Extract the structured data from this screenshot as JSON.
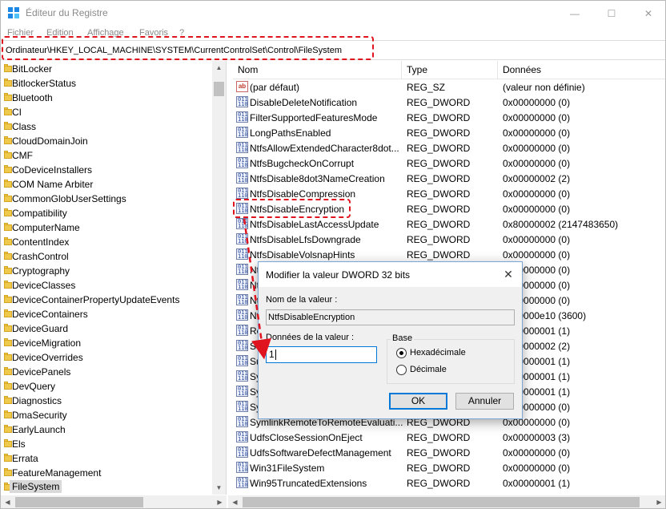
{
  "window": {
    "title": "Éditeur du Registre",
    "minimize_glyph": "—",
    "maximize_glyph": "☐",
    "close_glyph": "✕"
  },
  "menu": [
    "Fichier",
    "Edition",
    "Affichage",
    "Favoris",
    "?"
  ],
  "address": "Ordinateur\\HKEY_LOCAL_MACHINE\\SYSTEM\\CurrentControlSet\\Control\\FileSystem",
  "tree": {
    "items": [
      "BitLocker",
      "BitlockerStatus",
      "Bluetooth",
      "CI",
      "Class",
      "CloudDomainJoin",
      "CMF",
      "CoDeviceInstallers",
      "COM Name Arbiter",
      "CommonGlobUserSettings",
      "Compatibility",
      "ComputerName",
      "ContentIndex",
      "CrashControl",
      "Cryptography",
      "DeviceClasses",
      "DeviceContainerPropertyUpdateEvents",
      "DeviceContainers",
      "DeviceGuard",
      "DeviceMigration",
      "DeviceOverrides",
      "DevicePanels",
      "DevQuery",
      "Diagnostics",
      "DmaSecurity",
      "EarlyLaunch",
      "Els",
      "Errata",
      "FeatureManagement",
      "FileSystem"
    ],
    "selected": "FileSystem"
  },
  "list": {
    "headers": {
      "name": "Nom",
      "type": "Type",
      "data": "Données"
    },
    "rows": [
      {
        "icon": "string-value-icon",
        "name": "(par défaut)",
        "type": "REG_SZ",
        "data": "(valeur non définie)"
      },
      {
        "icon": "binary-value-icon",
        "name": "DisableDeleteNotification",
        "type": "REG_DWORD",
        "data": "0x00000000 (0)"
      },
      {
        "icon": "binary-value-icon",
        "name": "FilterSupportedFeaturesMode",
        "type": "REG_DWORD",
        "data": "0x00000000 (0)"
      },
      {
        "icon": "binary-value-icon",
        "name": "LongPathsEnabled",
        "type": "REG_DWORD",
        "data": "0x00000000 (0)"
      },
      {
        "icon": "binary-value-icon",
        "name": "NtfsAllowExtendedCharacter8dot...",
        "type": "REG_DWORD",
        "data": "0x00000000 (0)"
      },
      {
        "icon": "binary-value-icon",
        "name": "NtfsBugcheckOnCorrupt",
        "type": "REG_DWORD",
        "data": "0x00000000 (0)"
      },
      {
        "icon": "binary-value-icon",
        "name": "NtfsDisable8dot3NameCreation",
        "type": "REG_DWORD",
        "data": "0x00000002 (2)"
      },
      {
        "icon": "binary-value-icon",
        "name": "NtfsDisableCompression",
        "type": "REG_DWORD",
        "data": "0x00000000 (0)"
      },
      {
        "icon": "binary-value-icon",
        "name": "NtfsDisableEncryption",
        "type": "REG_DWORD",
        "data": "0x00000000 (0)"
      },
      {
        "icon": "binary-value-icon",
        "name": "NtfsDisableLastAccessUpdate",
        "type": "REG_DWORD",
        "data": "0x80000002 (2147483650)"
      },
      {
        "icon": "binary-value-icon",
        "name": "NtfsDisableLfsDowngrade",
        "type": "REG_DWORD",
        "data": "0x00000000 (0)"
      },
      {
        "icon": "binary-value-icon",
        "name": "NtfsDisableVolsnapHints",
        "type": "REG_DWORD",
        "data": "0x00000000 (0)"
      },
      {
        "icon": "binary-value-icon",
        "name": "Nt",
        "type": "REG_DWORD",
        "data": "0x00000000 (0)"
      },
      {
        "icon": "binary-value-icon",
        "name": "Nt",
        "type": "REG_DWORD",
        "data": "0x00000000 (0)"
      },
      {
        "icon": "binary-value-icon",
        "name": "Nt",
        "type": "REG_DWORD",
        "data": "0x00000000 (0)"
      },
      {
        "icon": "binary-value-icon",
        "name": "Nt",
        "type": "REG_DWORD",
        "data": "0x00000e10 (3600)"
      },
      {
        "icon": "binary-value-icon",
        "name": "Re",
        "type": "REG_DWORD",
        "data": "0x00000001 (1)"
      },
      {
        "icon": "binary-value-icon",
        "name": "Sc",
        "type": "REG_DWORD",
        "data": "0x00000002 (2)"
      },
      {
        "icon": "binary-value-icon",
        "name": "Su",
        "type": "REG_DWORD",
        "data": "0x00000001 (1)"
      },
      {
        "icon": "binary-value-icon",
        "name": "Sy",
        "type": "REG_DWORD",
        "data": "0x00000001 (1)"
      },
      {
        "icon": "binary-value-icon",
        "name": "Sy",
        "type": "REG_DWORD",
        "data": "0x00000001 (1)"
      },
      {
        "icon": "binary-value-icon",
        "name": "Sy",
        "type": "REG_DWORD",
        "data": "0x00000000 (0)"
      },
      {
        "icon": "binary-value-icon",
        "name": "SymlinkRemoteToRemoteEvaluati...",
        "type": "REG_DWORD",
        "data": "0x00000000 (0)"
      },
      {
        "icon": "binary-value-icon",
        "name": "UdfsCloseSessionOnEject",
        "type": "REG_DWORD",
        "data": "0x00000003 (3)"
      },
      {
        "icon": "binary-value-icon",
        "name": "UdfsSoftwareDefectManagement",
        "type": "REG_DWORD",
        "data": "0x00000000 (0)"
      },
      {
        "icon": "binary-value-icon",
        "name": "Win31FileSystem",
        "type": "REG_DWORD",
        "data": "0x00000000 (0)"
      },
      {
        "icon": "binary-value-icon",
        "name": "Win95TruncatedExtensions",
        "type": "REG_DWORD",
        "data": "0x00000001 (1)"
      }
    ]
  },
  "dialog": {
    "title": "Modifier la valeur DWORD 32 bits",
    "value_name_label": "Nom de la valeur :",
    "value_name": "NtfsDisableEncryption",
    "value_data_label": "Données de la valeur :",
    "value_data": "1",
    "base_label": "Base",
    "radio_hex": "Hexadécimale",
    "radio_dec": "Décimale",
    "selected_base": "Hexadécimale",
    "ok": "OK",
    "cancel": "Annuler"
  },
  "colors": {
    "highlight": "#e0141e",
    "accent": "#0078d7"
  }
}
